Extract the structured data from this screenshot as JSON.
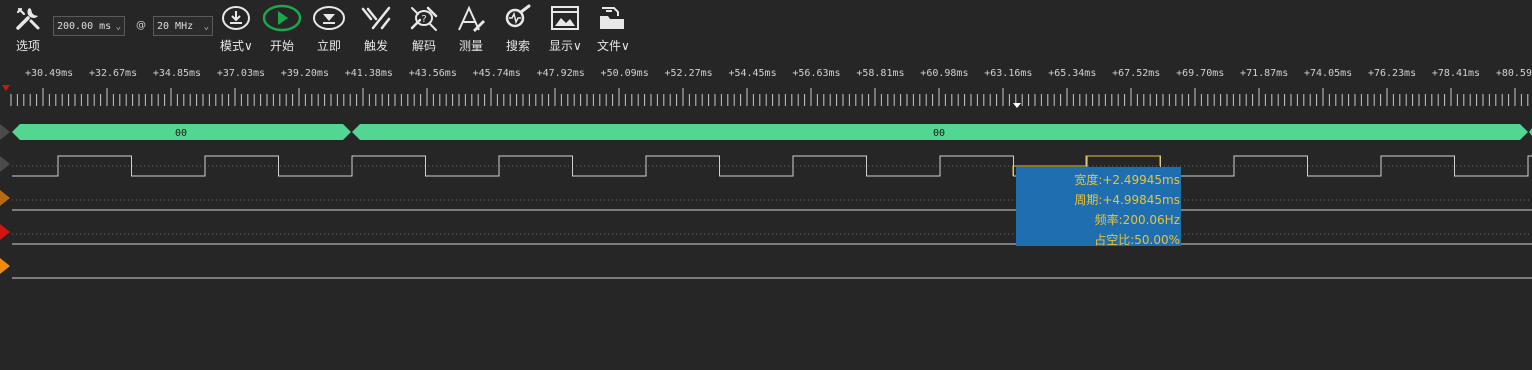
{
  "toolbar": {
    "options_label": "选项",
    "time_value": "200.00 ms",
    "at_symbol": "@",
    "rate_value": "20 MHz",
    "items": [
      {
        "label": "模式",
        "icon": "download-icon"
      },
      {
        "label": "开始",
        "icon": "play-icon"
      },
      {
        "label": "立即",
        "icon": "immediate-icon"
      },
      {
        "label": "触发",
        "icon": "trigger-icon"
      },
      {
        "label": "解码",
        "icon": "decode-icon"
      },
      {
        "label": "测量",
        "icon": "measure-icon"
      },
      {
        "label": "搜索",
        "icon": "search-icon"
      },
      {
        "label": "显示",
        "icon": "display-icon"
      },
      {
        "label": "文件",
        "icon": "file-icon"
      }
    ],
    "dropdown_glyph": "∨",
    "accent_color": "#19a84a"
  },
  "ruler": {
    "labels": [
      "+30.49ms",
      "+32.67ms",
      "+34.85ms",
      "+37.03ms",
      "+39.20ms",
      "+41.38ms",
      "+43.56ms",
      "+45.74ms",
      "+47.92ms",
      "+50.09ms",
      "+52.27ms",
      "+54.45ms",
      "+56.63ms",
      "+58.81ms",
      "+60.98ms",
      "+63.16ms",
      "+65.34ms",
      "+67.52ms",
      "+69.70ms",
      "+71.87ms",
      "+74.05ms",
      "+76.23ms",
      "+78.41ms",
      "+80.59"
    ]
  },
  "decode": {
    "segments": [
      "00",
      "00"
    ],
    "color": "#52d691"
  },
  "channels": {
    "colors": [
      "#4a4a4a",
      "#4a4a4a",
      "#b86a12",
      "#d01515",
      "#f08a10"
    ]
  },
  "measure": {
    "width": "宽度:+2.49945ms",
    "period": "周期:+4.99845ms",
    "frequency": "频率:200.06Hz",
    "duty": "占空比:50.00%",
    "bg_color": "#1f6fb0",
    "text_color": "#e8c23a"
  }
}
